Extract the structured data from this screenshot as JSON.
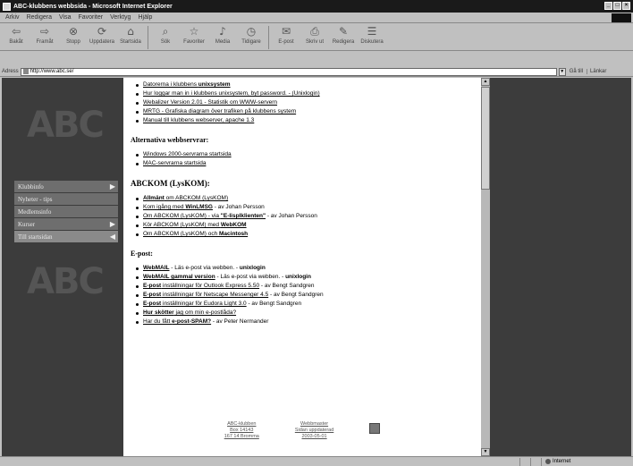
{
  "window": {
    "title": "ABC-klubbens webbsida - Microsoft Internet Explorer",
    "controls": [
      "_",
      "□",
      "×"
    ]
  },
  "menu": [
    "Arkiv",
    "Redigera",
    "Visa",
    "Favoriter",
    "Verktyg",
    "Hjälp"
  ],
  "toolbar": [
    {
      "icon": "back-arrow-icon",
      "glyph": "⇦",
      "label": "Bakåt"
    },
    {
      "icon": "forward-arrow-icon",
      "glyph": "⇨",
      "label": "Framåt"
    },
    {
      "icon": "stop-icon",
      "glyph": "⊗",
      "label": "Stopp"
    },
    {
      "icon": "refresh-icon",
      "glyph": "⟳",
      "label": "Uppdatera"
    },
    {
      "icon": "home-icon",
      "glyph": "⌂",
      "label": "Startsida"
    },
    {
      "icon": "search-icon",
      "glyph": "⌕",
      "label": "Sök"
    },
    {
      "icon": "favorites-icon",
      "glyph": "☆",
      "label": "Favoriter"
    },
    {
      "icon": "media-icon",
      "glyph": "♪",
      "label": "Media"
    },
    {
      "icon": "history-icon",
      "glyph": "◷",
      "label": "Tidigare"
    },
    {
      "icon": "mail-icon",
      "glyph": "✉",
      "label": "E-post"
    },
    {
      "icon": "print-icon",
      "glyph": "⎙",
      "label": "Skriv ut"
    },
    {
      "icon": "edit-icon",
      "glyph": "✎",
      "label": "Redigera"
    },
    {
      "icon": "discuss-icon",
      "glyph": "☰",
      "label": "Diskutera"
    }
  ],
  "address": {
    "label": "Adress",
    "url": "http://www.abc.se/",
    "go": "Gå till",
    "links": "Länkar"
  },
  "logo": "ABC",
  "nav": [
    {
      "label": "Klubbinfo",
      "arrow": "▶",
      "active": false
    },
    {
      "label": "Nyheter - tips",
      "arrow": "",
      "active": false
    },
    {
      "label": "Medlemsinfo",
      "arrow": "",
      "active": false
    },
    {
      "label": "Kurser",
      "arrow": "▶",
      "active": false
    },
    {
      "label": "Till startsidan",
      "arrow": "◀",
      "active": true
    }
  ],
  "content": {
    "top_links": [
      {
        "pre": "",
        "link": "Datorerna i klubbens",
        "bold": "unixsystem",
        "post": ""
      },
      {
        "pre": "",
        "link": "Hur loggar man in i klubbens unixsystem, byt password. - (",
        "bold": "",
        "post": "Unixlogin)"
      },
      {
        "pre": "",
        "link": "Webalizer Version 2.01 - Statistik om WWW-servern",
        "bold": "",
        "post": ""
      },
      {
        "pre": "",
        "link": "MRTG - Grafiska diagram över trafiken på klubbens system",
        "bold": "",
        "post": ""
      },
      {
        "pre": "",
        "link": "Manual till klubbens webserver, apache 1.3",
        "bold": "",
        "post": ""
      }
    ],
    "alt_heading": "Alternativa webbservrar:",
    "alt_links": [
      "Windows 2000-servrarna startsida",
      "MAC-servrarna startsida"
    ],
    "kom_heading": "ABCKOM (LysKOM):",
    "kom_links": [
      {
        "bold": "Allmänt",
        "link": " om ABCKOM (LysKOM)",
        "post": ""
      },
      {
        "bold": "",
        "link": "Kom igång med ",
        "link_bold": "WinLMSG",
        "post": " - av Johan Persson"
      },
      {
        "bold": "",
        "link": "Om ABCKOM (LysKOM) - via ",
        "link_bold": "\"E-lisplklienten\"",
        "post": " - av Johan Persson"
      },
      {
        "bold": "",
        "link": "Kör ABCKOM (LysKOM) med ",
        "link_bold": "WebKOM",
        "post": ""
      },
      {
        "bold": "",
        "link": "Om ABCKOM (LysKOM) och ",
        "link_bold": "Macintosh",
        "post": ""
      }
    ],
    "mail_heading": "E-post:",
    "mail_links": [
      {
        "link_bold": "WebMAIL",
        "link": "",
        "post": " - Läs e-post via webben. - ",
        "post_bold": "unixlogin"
      },
      {
        "link_bold": "WebMAIL gammal version",
        "link": "",
        "post": " - Läs e-post via webben. - ",
        "post_bold": "unixlogin"
      },
      {
        "link_bold": "E-post",
        "link": " inställningar för Outlook Express 5.50",
        "post": " - av Bengt Sandgren",
        "post_bold": ""
      },
      {
        "link_bold": "E-post",
        "link": " inställningar för Netscape Messenger 4.5",
        "post": " - av Bengt Sandgren",
        "post_bold": ""
      },
      {
        "link_bold": "E-post",
        "link": " inställningar för Eudora Light 3.0",
        "post": " - av Bengt Sandgren",
        "post_bold": ""
      },
      {
        "link_bold": "Hur skötter",
        "link": " jag om min e-postlåda?",
        "post": "",
        "post_bold": ""
      },
      {
        "link_bold": "",
        "link": "Har du fått ",
        "link_bold2": "e-post-SPAM?",
        "post": " - av Peter Nermander",
        "post_bold": ""
      }
    ],
    "footer": {
      "left": [
        "ABC-klubben",
        "Box 14143",
        "167 14 Bromma"
      ],
      "mid": [
        "Webbmaster",
        "Sidan uppdaterad",
        "2003-05-01"
      ]
    }
  },
  "status": {
    "left": "",
    "zone": "Internet"
  }
}
